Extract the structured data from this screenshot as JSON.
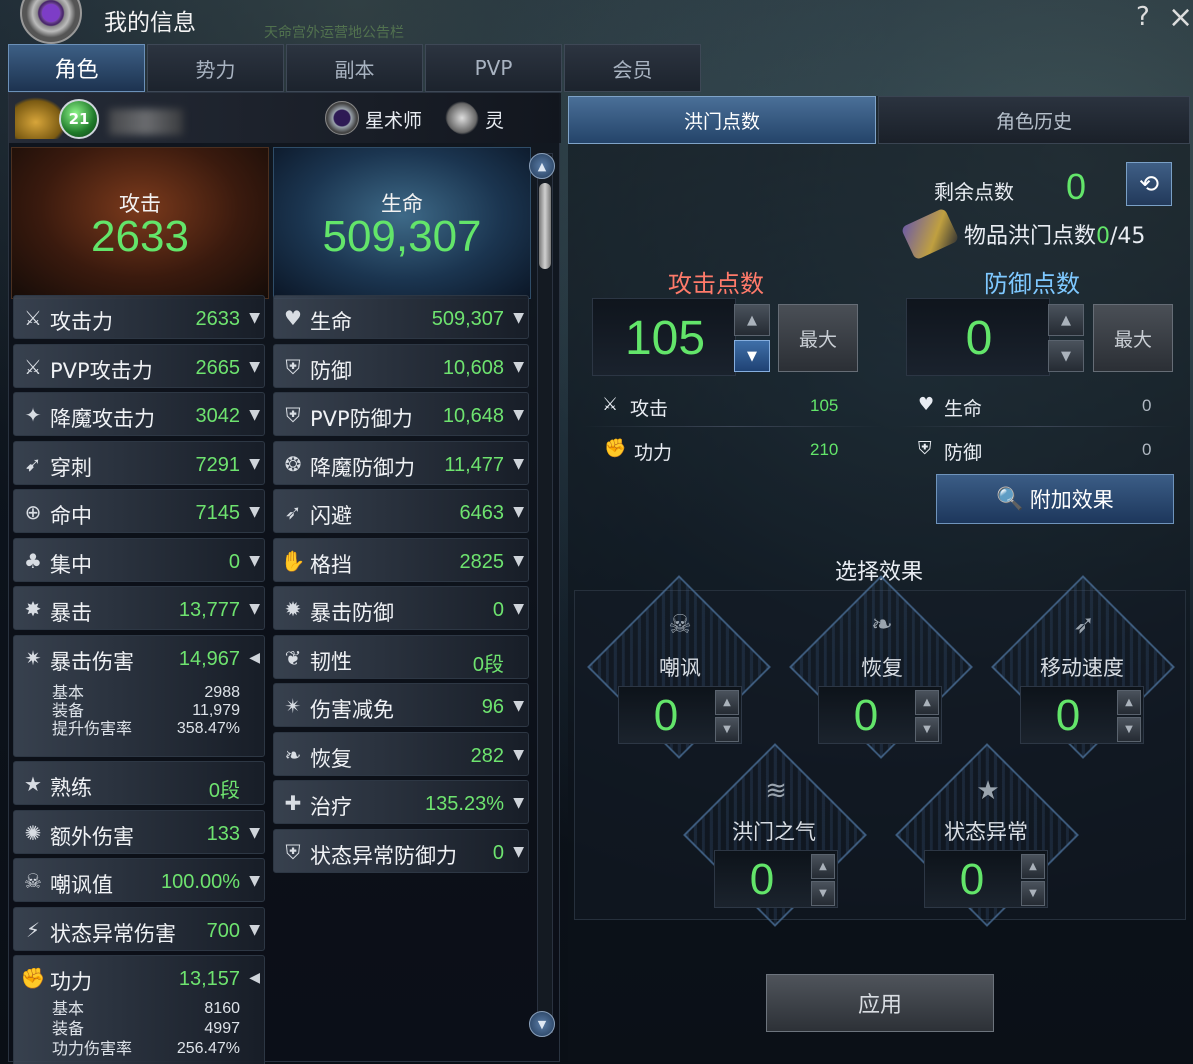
{
  "window": {
    "title": "我的信息",
    "help": "?",
    "close": "×",
    "notice": "天命宫外运营地公告栏"
  },
  "tabs": [
    "角色",
    "势力",
    "副本",
    "PVP",
    "会员"
  ],
  "character": {
    "level": "21",
    "class": "星术师",
    "race": "灵"
  },
  "hero": {
    "attack_label": "攻击",
    "attack_value": "2633",
    "hp_label": "生命",
    "hp_value": "509,307"
  },
  "stats_left": [
    {
      "icon": "sword-icon",
      "label": "攻击力",
      "value": "2633"
    },
    {
      "icon": "pvp-attack-icon",
      "label": "PVP攻击力",
      "value": "2665"
    },
    {
      "icon": "demon-attack-icon",
      "label": "降魔攻击力",
      "value": "3042"
    },
    {
      "icon": "pierce-icon",
      "label": "穿刺",
      "value": "7291"
    },
    {
      "icon": "crosshair-icon",
      "label": "命中",
      "value": "7145"
    },
    {
      "icon": "focus-icon",
      "label": "集中",
      "value": "0"
    },
    {
      "icon": "critical-icon",
      "label": "暴击",
      "value": "13,777"
    }
  ],
  "crit_damage": {
    "label": "暴击伤害",
    "value": "14,967",
    "details": [
      {
        "k": "基本",
        "v": "2988"
      },
      {
        "k": "装备",
        "v": "11,979"
      },
      {
        "k": "提升伤害率",
        "v": "358.47%"
      }
    ]
  },
  "stats_left2": [
    {
      "icon": "mastery-icon",
      "label": "熟练",
      "value": "0段"
    },
    {
      "icon": "extra-damage-icon",
      "label": "额外伤害",
      "value": "133"
    },
    {
      "icon": "skull-icon",
      "label": "嘲讽值",
      "value": "100.00%"
    },
    {
      "icon": "status-damage-icon",
      "label": "状态异常伤害",
      "value": "700"
    }
  ],
  "power": {
    "label": "功力",
    "value": "13,157",
    "details": [
      {
        "k": "基本",
        "v": "8160"
      },
      {
        "k": "装备",
        "v": "4997"
      },
      {
        "k": "功力伤害率",
        "v": "256.47%"
      }
    ]
  },
  "stats_right": [
    {
      "icon": "heart-icon",
      "label": "生命",
      "value": "509,307"
    },
    {
      "icon": "shield-icon",
      "label": "防御",
      "value": "10,608"
    },
    {
      "icon": "pvp-defense-icon",
      "label": "PVP防御力",
      "value": "10,648"
    },
    {
      "icon": "demon-defense-icon",
      "label": "降魔防御力",
      "value": "11,477"
    },
    {
      "icon": "evade-icon",
      "label": "闪避",
      "value": "6463"
    },
    {
      "icon": "block-icon",
      "label": "格挡",
      "value": "2825"
    },
    {
      "icon": "crit-defense-icon",
      "label": "暴击防御",
      "value": "0"
    },
    {
      "icon": "toughness-icon",
      "label": "韧性",
      "value": "0段"
    },
    {
      "icon": "damage-reduction-icon",
      "label": "伤害减免",
      "value": "96"
    },
    {
      "icon": "sprout-icon",
      "label": "恢复",
      "value": "282"
    },
    {
      "icon": "heal-icon",
      "label": "治疗",
      "value": "135.23%"
    },
    {
      "icon": "status-defense-icon",
      "label": "状态异常防御力",
      "value": "0"
    }
  ],
  "right": {
    "tab_active": "洪门点数",
    "tab_history": "角色历史",
    "remaining_label": "剩余点数",
    "remaining_value": "0",
    "item_label": "物品洪门点数",
    "item_current": "0",
    "item_total": "/45",
    "attack_header": "攻击点数",
    "defense_header": "防御点数",
    "attack_points": "105",
    "defense_points": "0",
    "max_label": "最大",
    "attack_stats": [
      {
        "label": "攻击",
        "value": "105"
      },
      {
        "label": "功力",
        "value": "210"
      }
    ],
    "defense_stats": [
      {
        "label": "生命",
        "value": "0"
      },
      {
        "label": "防御",
        "value": "0"
      }
    ],
    "add_effect": "附加效果",
    "select_title": "选择效果",
    "effects": [
      {
        "label": "嘲讽",
        "value": "0"
      },
      {
        "label": "恢复",
        "value": "0"
      },
      {
        "label": "移动速度",
        "value": "0"
      },
      {
        "label": "洪门之气",
        "value": "0"
      },
      {
        "label": "状态异常",
        "value": "0"
      }
    ],
    "apply": "应用"
  }
}
